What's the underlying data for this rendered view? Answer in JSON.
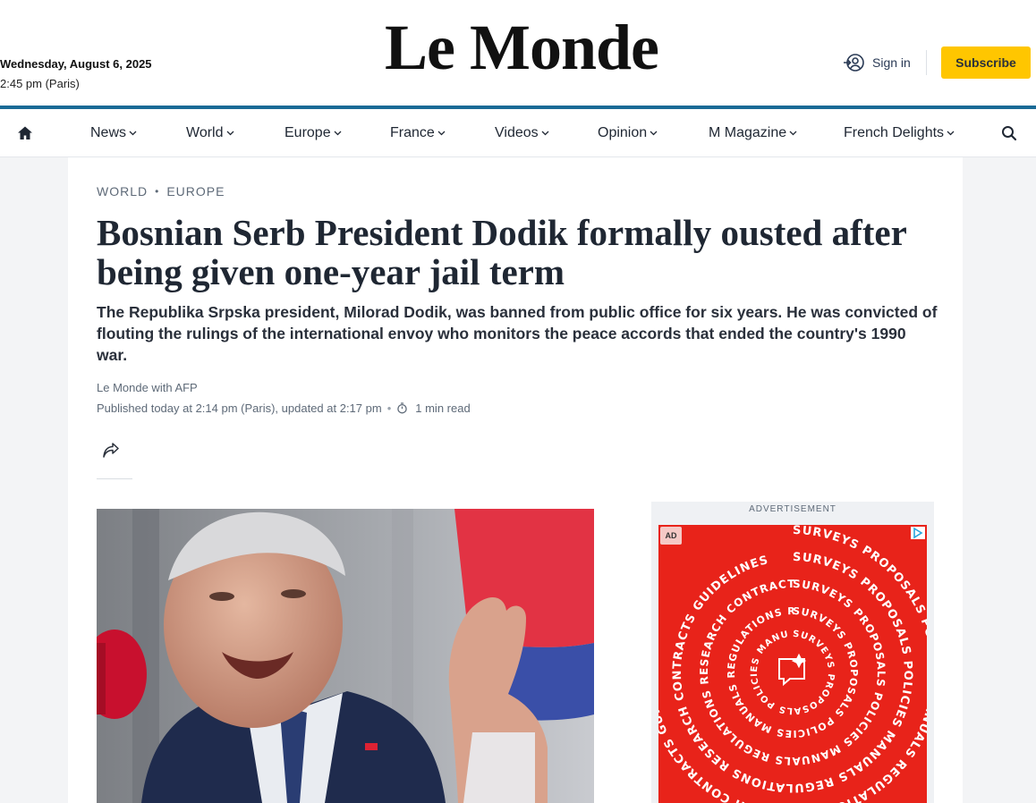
{
  "header": {
    "date": "Wednesday, August 6, 2025",
    "time": "2:45 pm (Paris)",
    "logo": "Le Monde",
    "signin_label": "Sign in",
    "subscribe_label": "Subscribe"
  },
  "nav": {
    "items": [
      {
        "label": "News"
      },
      {
        "label": "World"
      },
      {
        "label": "Europe"
      },
      {
        "label": "France"
      },
      {
        "label": "Videos"
      },
      {
        "label": "Opinion"
      },
      {
        "label": "M Magazine"
      },
      {
        "label": "French Delights"
      }
    ]
  },
  "article": {
    "breadcrumbs": [
      "WORLD",
      "EUROPE"
    ],
    "title": "Bosnian Serb President Dodik formally ousted after being given one-year jail term",
    "lede": "The Republika Srpska president, Milorad Dodik, was banned from public office for six years. He was convicted of flouting the rulings of the international envoy who monitors the peace accords that ended the country's 1990 war.",
    "byline": "Le Monde with AFP",
    "published": "Published today at 2:14 pm (Paris), updated at 2:17 pm",
    "read_time": "1 min read"
  },
  "ad": {
    "label": "ADVERTISEMENT",
    "badge": "AD",
    "spiral_words": "SURVEYS PROPOSALS POLICIES MANUALS REGULATIONS RESEARCH CONTRACTS GUIDELINES"
  },
  "colors": {
    "brand_blue": "#1a6a96",
    "subscribe_yellow": "#ffc600",
    "ad_red": "#e8231a"
  }
}
